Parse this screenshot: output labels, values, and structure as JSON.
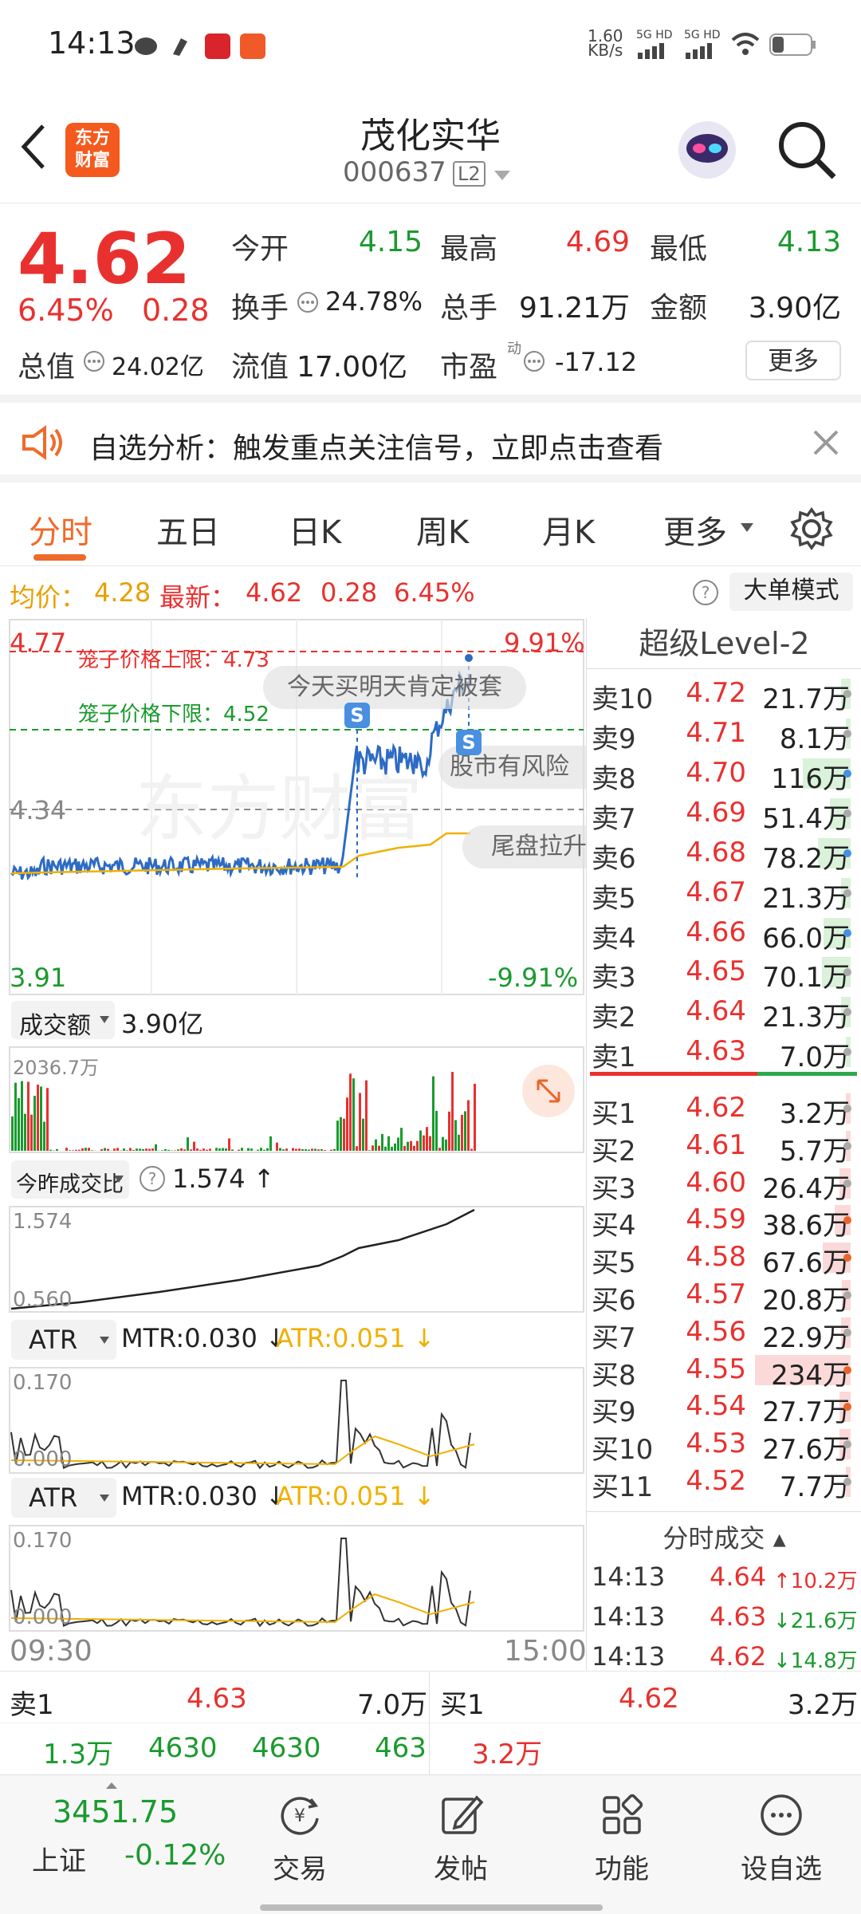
{
  "status_bar": {
    "time": "14:13",
    "net_speed": "1.60",
    "net_unit": "KB/s",
    "sim1": "5G HD",
    "sim2": "5G HD"
  },
  "header": {
    "back_icon": "chevron-left-icon",
    "brand": "东方财富",
    "title": "茂化实华",
    "code": "000637",
    "level_badge": "L2",
    "search_icon": "search-icon",
    "avatar_icon": "robot-avatar-icon"
  },
  "quote": {
    "price": "4.62",
    "change_pct": "6.45%",
    "change": "0.28",
    "open_label": "今开",
    "open": "4.15",
    "high_label": "最高",
    "high": "4.69",
    "low_label": "最低",
    "low": "4.13",
    "turnover_label": "换手",
    "turnover": "24.78%",
    "volume_label": "总手",
    "volume": "91.21万",
    "amount_label": "金额",
    "amount": "3.90亿",
    "mktcap_label": "总值",
    "mktcap": "24.02亿",
    "float_label": "流值",
    "float": "17.00亿",
    "pe_label": "市盈",
    "pe_sup": "动",
    "pe": "-17.12",
    "more_button": "更多"
  },
  "notice": {
    "text": "自选分析：触发重点关注信号，立即点击查看",
    "speaker_icon": "speaker-icon",
    "close_icon": "close-icon"
  },
  "tabs": [
    "分时",
    "五日",
    "日K",
    "周K",
    "月K",
    "更多"
  ],
  "active_tab": "分时",
  "info_row": {
    "avg_label": "均价：",
    "avg": "4.28",
    "latest_label": "最新：",
    "latest": "4.62",
    "change": "0.28",
    "change_pct": "6.45%",
    "big_order_button": "大单模式"
  },
  "chart_left": {
    "top_price": "4.77",
    "top_pct": "9.91%",
    "mid_price": "4.34",
    "bottom_price": "3.91",
    "bottom_pct": "-9.91%",
    "upper_limit_label": "笼子价格上限：4.73",
    "lower_limit_label": "笼子价格下限：4.52",
    "bubble1": "今天买明天肯定被套",
    "bubble2": "股市有风险",
    "bubble3": "尾盘拉升",
    "marker": "S",
    "watermark": "东方财富",
    "vol_selector": "成交额",
    "vol_total": "3.90亿",
    "vol_max": "2036.7万",
    "ratio_selector": "今昨成交比",
    "ratio_value": "1.574",
    "ratio_max": "1.574",
    "ratio_min": "0.560",
    "atr1_selector": "ATR",
    "atr1_mtr": "MTR:0.030",
    "atr1_atr": "ATR:0.051",
    "atr1_max": "0.170",
    "atr1_min": "0.000",
    "atr2_selector": "ATR",
    "atr2_mtr": "MTR:0.030",
    "atr2_atr": "ATR:0.051",
    "atr2_max": "0.170",
    "atr2_min": "0.000",
    "time_start": "09:30",
    "time_end": "15:00",
    "colors": {
      "price_line": "#2d6bc4",
      "avg_line": "#f0b000",
      "up": "#e8312f",
      "down": "#1a9a2e"
    }
  },
  "orderbook": {
    "title": "超级Level-2",
    "asks": [
      {
        "label": "卖10",
        "price": "4.72",
        "vol": "21.7万",
        "bar": 0.1
      },
      {
        "label": "卖9",
        "price": "4.71",
        "vol": "8.1万",
        "bar": 0.04
      },
      {
        "label": "卖8",
        "price": "4.70",
        "vol": "116万",
        "bar": 0.5
      },
      {
        "label": "卖7",
        "price": "4.69",
        "vol": "51.4万",
        "bar": 0.22
      },
      {
        "label": "卖6",
        "price": "4.68",
        "vol": "78.2万",
        "bar": 0.34
      },
      {
        "label": "卖5",
        "price": "4.67",
        "vol": "21.3万",
        "bar": 0.1
      },
      {
        "label": "卖4",
        "price": "4.66",
        "vol": "66.0万",
        "bar": 0.28
      },
      {
        "label": "卖3",
        "price": "4.65",
        "vol": "70.1万",
        "bar": 0.3
      },
      {
        "label": "卖2",
        "price": "4.64",
        "vol": "21.3万",
        "bar": 0.1
      },
      {
        "label": "卖1",
        "price": "4.63",
        "vol": "7.0万",
        "bar": 0.04
      }
    ],
    "bids": [
      {
        "label": "买1",
        "price": "4.62",
        "vol": "3.2万",
        "bar": 0.03
      },
      {
        "label": "买2",
        "price": "4.61",
        "vol": "5.7万",
        "bar": 0.04
      },
      {
        "label": "买3",
        "price": "4.60",
        "vol": "26.4万",
        "bar": 0.12
      },
      {
        "label": "买4",
        "price": "4.59",
        "vol": "38.6万",
        "bar": 0.17
      },
      {
        "label": "买5",
        "price": "4.58",
        "vol": "67.6万",
        "bar": 0.29
      },
      {
        "label": "买6",
        "price": "4.57",
        "vol": "20.8万",
        "bar": 0.09
      },
      {
        "label": "买7",
        "price": "4.56",
        "vol": "22.9万",
        "bar": 0.1
      },
      {
        "label": "买8",
        "price": "4.55",
        "vol": "234万",
        "bar": 1.0
      },
      {
        "label": "买9",
        "price": "4.54",
        "vol": "27.7万",
        "bar": 0.12
      },
      {
        "label": "买10",
        "price": "4.53",
        "vol": "27.6万",
        "bar": 0.12
      },
      {
        "label": "买11",
        "price": "4.52",
        "vol": "7.7万",
        "bar": 0.04
      }
    ],
    "ticks_title": "分时成交",
    "ticks": [
      {
        "time": "14:13",
        "price": "4.64",
        "dir": "↑",
        "vol": "10.2万",
        "color": "red"
      },
      {
        "time": "14:13",
        "price": "4.63",
        "dir": "↓",
        "vol": "21.6万",
        "color": "green"
      },
      {
        "time": "14:13",
        "price": "4.62",
        "dir": "↓",
        "vol": "14.8万",
        "color": "green"
      }
    ]
  },
  "trade_row": {
    "sell_label": "卖1",
    "sell_price": "4.63",
    "sell_vol": "7.0万",
    "buy_label": "买1",
    "buy_price": "4.62",
    "buy_vol": "3.2万",
    "cells": [
      "1.3万",
      "4630",
      "4630",
      "463"
    ],
    "buy_cell": "3.2万"
  },
  "bottom_nav": {
    "index_value": "3451.75",
    "index_name": "上证",
    "index_change": "-0.12%",
    "items": [
      {
        "label": "交易",
        "icon": "yuan-refresh-icon"
      },
      {
        "label": "发帖",
        "icon": "edit-icon"
      },
      {
        "label": "功能",
        "icon": "grid-icon"
      },
      {
        "label": "设自选",
        "icon": "more-dots-icon"
      }
    ]
  }
}
